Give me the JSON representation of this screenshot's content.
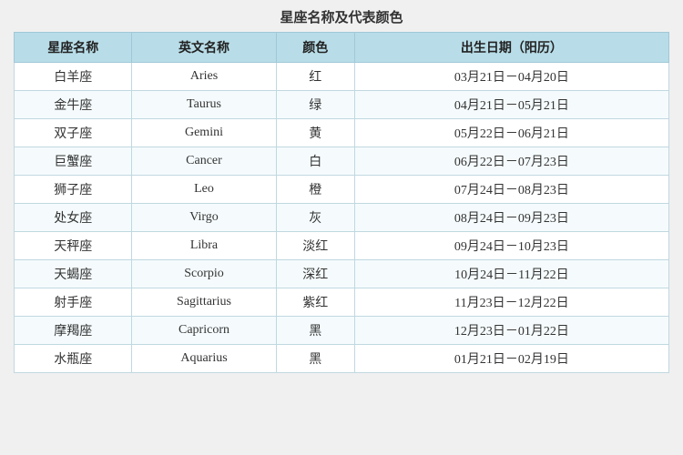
{
  "title": "星座名称及代表颜色",
  "headers": {
    "chinese": "星座名称",
    "english": "英文名称",
    "color": "颜色",
    "date": "出生日期（阳历）"
  },
  "rows": [
    {
      "chinese": "白羊座",
      "english": "Aries",
      "color": "红",
      "date": "03月21日－04月20日"
    },
    {
      "chinese": "金牛座",
      "english": "Taurus",
      "color": "绿",
      "date": "04月21日－05月21日"
    },
    {
      "chinese": "双子座",
      "english": "Gemini",
      "color": "黄",
      "date": "05月22日－06月21日"
    },
    {
      "chinese": "巨蟹座",
      "english": "Cancer",
      "color": "白",
      "date": "06月22日－07月23日"
    },
    {
      "chinese": "狮子座",
      "english": "Leo",
      "color": "橙",
      "date": "07月24日－08月23日"
    },
    {
      "chinese": "处女座",
      "english": "Virgo",
      "color": "灰",
      "date": "08月24日－09月23日"
    },
    {
      "chinese": "天秤座",
      "english": "Libra",
      "color": "淡红",
      "date": "09月24日－10月23日"
    },
    {
      "chinese": "天蝎座",
      "english": "Scorpio",
      "color": "深红",
      "date": "10月24日－11月22日"
    },
    {
      "chinese": "射手座",
      "english": "Sagittarius",
      "color": "紫红",
      "date": "11月23日－12月22日"
    },
    {
      "chinese": "摩羯座",
      "english": "Capricorn",
      "color": "黑",
      "date": "12月23日－01月22日"
    },
    {
      "chinese": "水瓶座",
      "english": "Aquarius",
      "color": "黑",
      "date": "01月21日－02月19日"
    }
  ]
}
